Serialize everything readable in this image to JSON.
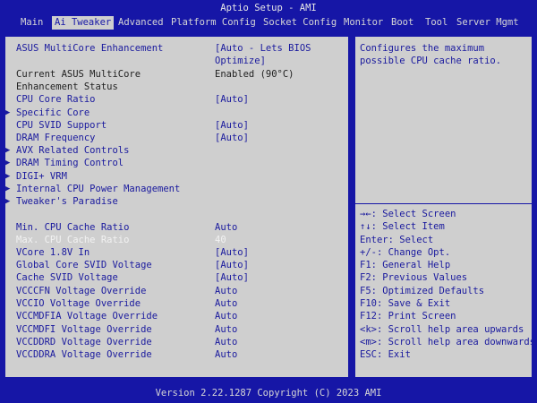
{
  "title": "Aptio Setup - AMI",
  "tabs": [
    "Main",
    "Ai Tweaker",
    "Advanced",
    "Platform Config",
    "Socket Config",
    "Monitor",
    "Boot",
    "Tool",
    "Server Mgmt"
  ],
  "settings": [
    {
      "label": "ASUS MultiCore Enhancement",
      "value": "[Auto - Lets BIOS"
    },
    {
      "label": "",
      "value": "Optimize]"
    },
    {
      "label": "Current ASUS MultiCore",
      "value": "Enabled (90°C)"
    },
    {
      "label": "Enhancement Status",
      "value": ""
    },
    {
      "label": "CPU Core Ratio",
      "value": "[Auto]"
    },
    {
      "label": "Specific Core",
      "value": ""
    },
    {
      "label": "CPU SVID Support",
      "value": "[Auto]"
    },
    {
      "label": "DRAM Frequency",
      "value": "[Auto]"
    },
    {
      "label": "AVX Related Controls",
      "value": ""
    },
    {
      "label": "DRAM Timing Control",
      "value": ""
    },
    {
      "label": "DIGI+ VRM",
      "value": ""
    },
    {
      "label": "Internal CPU Power Management",
      "value": ""
    },
    {
      "label": "Tweaker's Paradise",
      "value": ""
    },
    {
      "label": "Min. CPU Cache Ratio",
      "value": "Auto"
    },
    {
      "label": "Max. CPU Cache Ratio",
      "value": "40"
    },
    {
      "label": "VCore 1.8V In",
      "value": "[Auto]"
    },
    {
      "label": "Global Core SVID Voltage",
      "value": "[Auto]"
    },
    {
      "label": "Cache SVID Voltage",
      "value": "[Auto]"
    },
    {
      "label": "VCCCFN Voltage Override",
      "value": "Auto"
    },
    {
      "label": "VCCIO Voltage Override",
      "value": "Auto"
    },
    {
      "label": "VCCMDFIA Voltage Override",
      "value": "Auto"
    },
    {
      "label": "VCCMDFI Voltage Override",
      "value": "Auto"
    },
    {
      "label": "VCCDDRD Voltage Override",
      "value": "Auto"
    },
    {
      "label": "VCCDDRA Voltage Override",
      "value": "Auto"
    }
  ],
  "help_lines": [
    "Configures the maximum",
    "possible CPU cache ratio."
  ],
  "keys": [
    "→←: Select Screen",
    "↑↓: Select Item",
    "Enter: Select",
    "+/-: Change Opt.",
    "F1: General Help",
    "F2: Previous Values",
    "F5: Optimized Defaults",
    "F10: Save & Exit",
    "F12: Print Screen",
    "<k>: Scroll help area upwards",
    "<m>: Scroll help area downwards",
    "ESC: Exit"
  ],
  "footer": "Version 2.22.1287 Copyright (C) 2023 AMI",
  "icons": {
    "submenu": "submenu-arrow-icon",
    "scroll_up": "scroll-up-icon",
    "scroll_down": "scroll-down-icon"
  },
  "colors": {
    "frame": "#1616a6",
    "panel": "#cfcfcf",
    "text": "#1a1a9e",
    "highlight": "#f2f2f2"
  }
}
